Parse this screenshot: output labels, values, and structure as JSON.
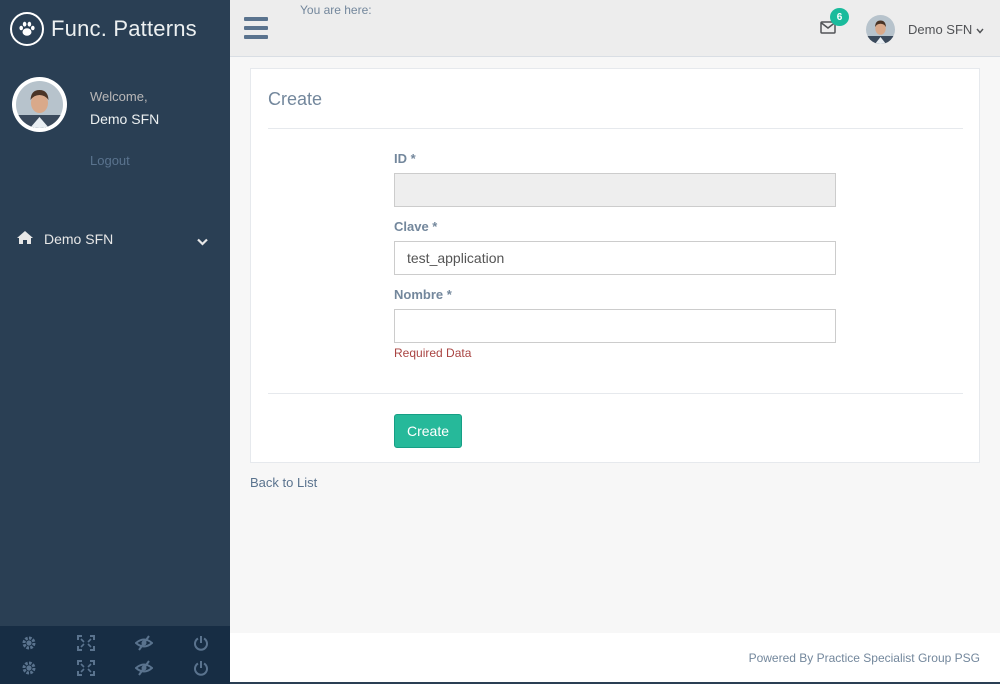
{
  "brand": {
    "title": "Func. Patterns",
    "icon": "paw-icon"
  },
  "profile": {
    "welcome": "Welcome,",
    "name": "Demo SFN",
    "logout_label": "Logout"
  },
  "sidebar": {
    "menu": [
      {
        "label": "Demo SFN",
        "icon": "home-icon",
        "expand_icon": "chevron-down-icon"
      }
    ],
    "footer_buttons": [
      "settings-icon",
      "fullscreen-icon",
      "eye-slash-icon",
      "power-icon"
    ]
  },
  "topnav": {
    "breadcrumb": "You are here:",
    "mail_count": "6",
    "user_name": "Demo SFN"
  },
  "form": {
    "title": "Create",
    "fields": [
      {
        "label": "ID *",
        "value": "",
        "disabled": true
      },
      {
        "label": "Clave *",
        "value": "test_application"
      },
      {
        "label": "Nombre *",
        "value": "",
        "error": "Required Data"
      }
    ],
    "submit_label": "Create"
  },
  "back_link": "Back to List",
  "footer": {
    "text": "Powered By Practice Specialist Group PSG"
  },
  "colors": {
    "sidebar": "#2a3f54",
    "accent": "#26b99a",
    "error": "#a94442"
  }
}
